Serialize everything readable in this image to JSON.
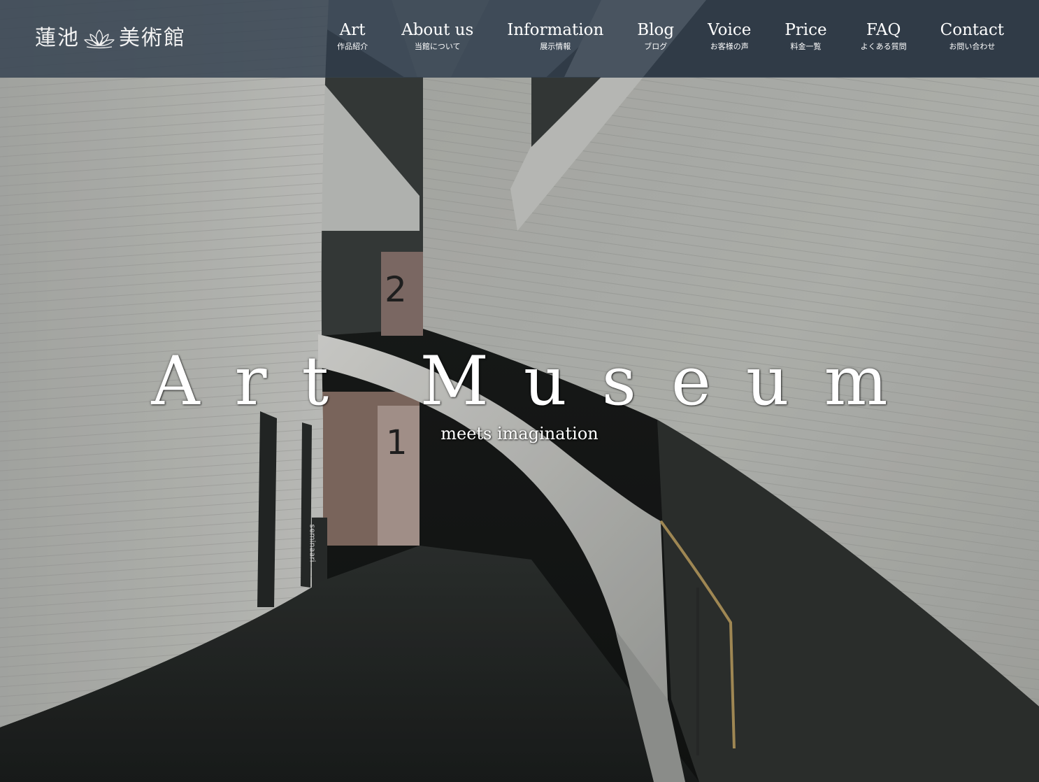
{
  "header": {
    "logo": {
      "left_text": "蓮池",
      "right_text": "美術館",
      "icon": "lotus-icon"
    },
    "nav": [
      {
        "en": "Art",
        "ja": "作品紹介"
      },
      {
        "en": "About us",
        "ja": "当館について"
      },
      {
        "en": "Information",
        "ja": "展示情報"
      },
      {
        "en": "Blog",
        "ja": "ブログ"
      },
      {
        "en": "Voice",
        "ja": "お客様の声"
      },
      {
        "en": "Price",
        "ja": "料金一覧"
      },
      {
        "en": "FAQ",
        "ja": "よくある質問"
      },
      {
        "en": "Contact",
        "ja": "お問い合わせ"
      }
    ]
  },
  "hero": {
    "title": "Art Museum",
    "subtitle": "meets imagination",
    "floor_signs": [
      "2",
      "1"
    ],
    "wall_sign": "seminaari"
  },
  "colors": {
    "header_bg": "#344250",
    "text": "#ffffff",
    "wall": "#c9cbc6",
    "floor": "#2a2e2c"
  }
}
